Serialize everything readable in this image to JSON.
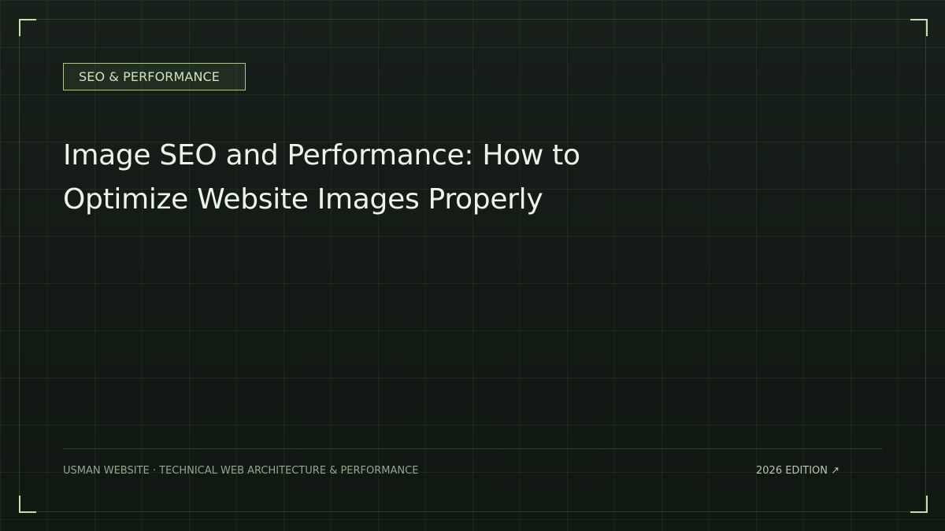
{
  "tag": {
    "label": "SEO & PERFORMANCE"
  },
  "headline": {
    "line1": "Image SEO and Performance: How to",
    "line2": "Optimize Website Images Properly"
  },
  "footer": {
    "left": "USMAN WEBSITE · TECHNICAL WEB ARCHITECTURE & PERFORMANCE",
    "right": "2026 EDITION ↗"
  },
  "colors": {
    "background": "#131a15",
    "accent": "#cfe3b8",
    "title": "#eef3ea",
    "muted": "#93a690"
  }
}
